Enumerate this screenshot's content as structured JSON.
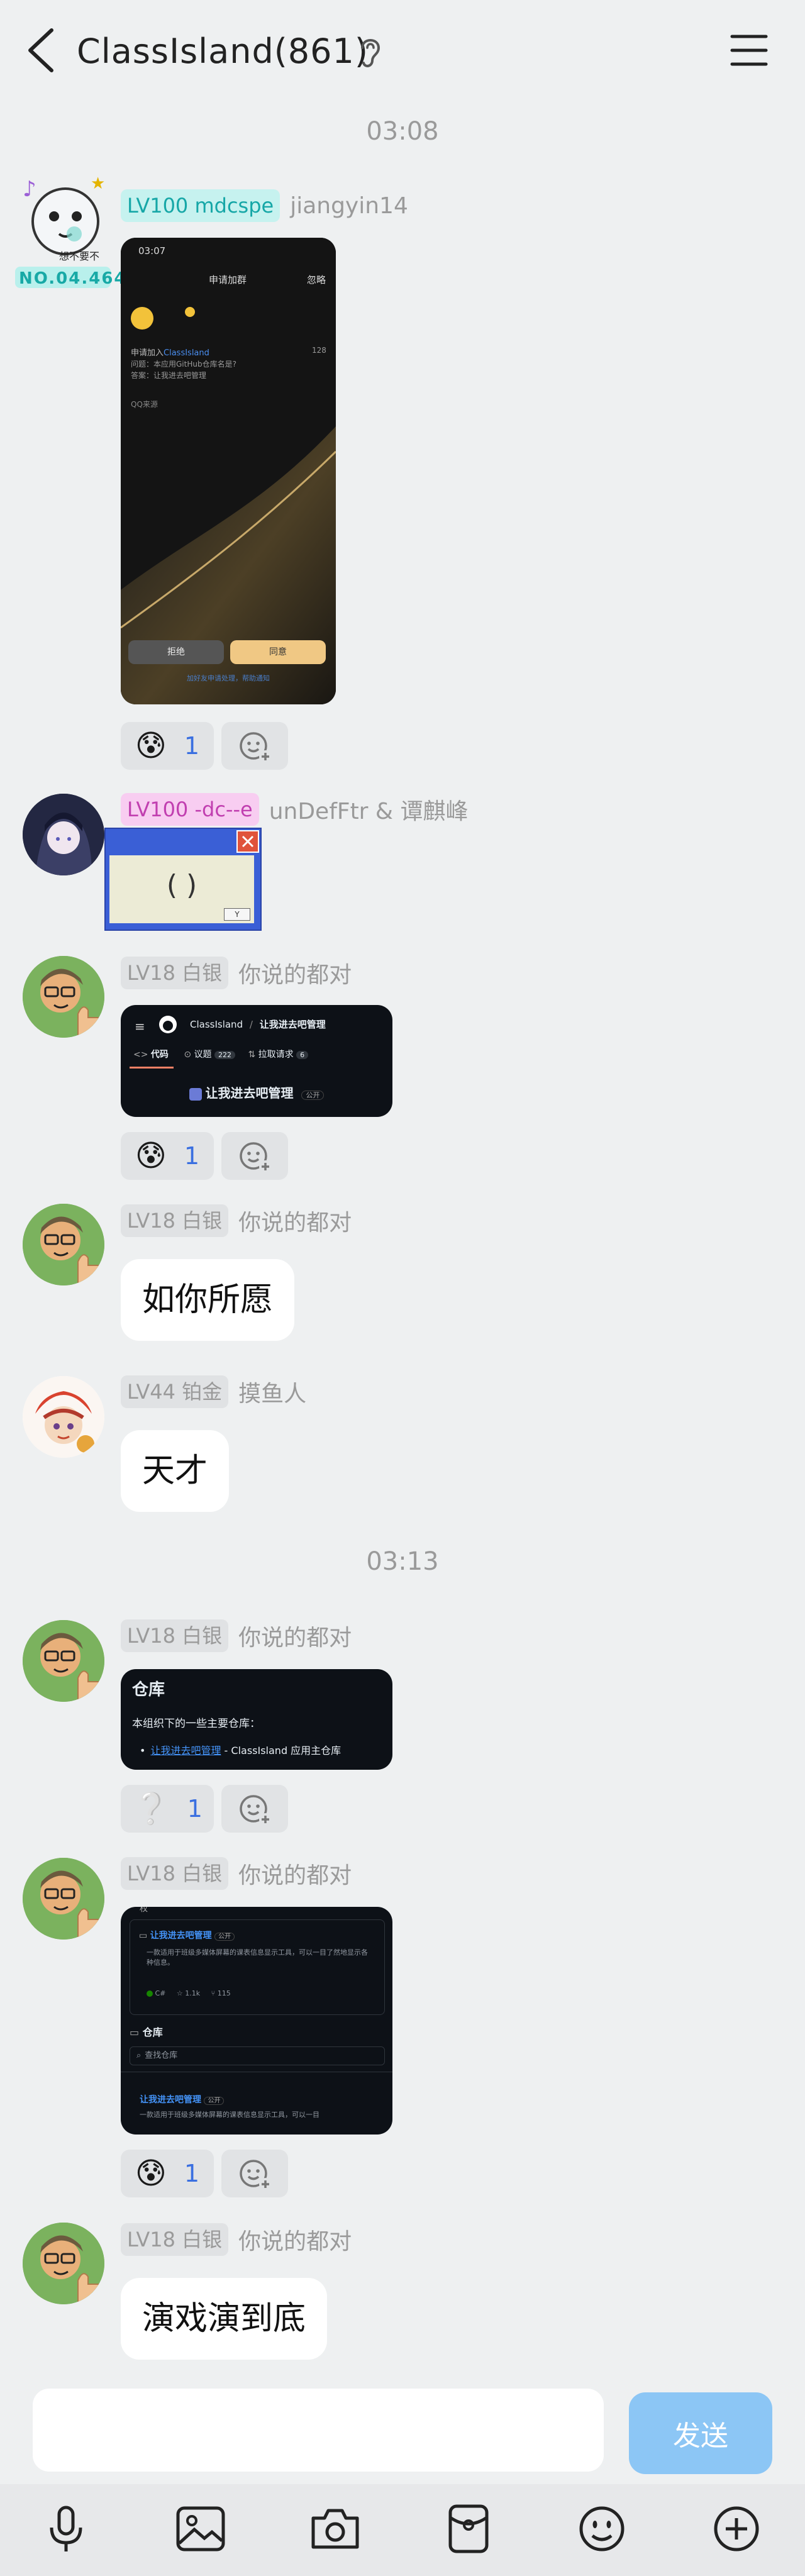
{
  "header": {
    "title": "ClassIsland(861)",
    "back_icon": "back-arrow-icon",
    "ear_icon": "ear-mode-icon",
    "menu_icon": "menu-icon"
  },
  "timestamps": [
    "03:08",
    "03:13"
  ],
  "messages": [
    {
      "badge": "LV100 mdcspe",
      "nickname": "jiangyin14",
      "avatar_caption": "想不要不",
      "avatar_code": "NO.04.464",
      "image_kind": "phone-screenshot",
      "screenshot": {
        "time": "03:07",
        "title": "申请加群",
        "ignore": "忽略",
        "apply_prefix": "申请加入",
        "apply_group": "ClassIsland",
        "count": "128",
        "question": "问题：本应用GitHub仓库名是?",
        "answer": "答案：让我进去吧管理",
        "source": "QQ来源",
        "reject": "拒绝",
        "accept": "同意",
        "footer": "加好友申请处理，帮助通知"
      },
      "reaction": {
        "emoji": "cold-sweat-emoji",
        "count": "1"
      }
    },
    {
      "badge": "LV100 -dc--e",
      "nickname": "unDefFtr & 谭麒峰",
      "sticker_text": "( )",
      "sticker_button": "Y",
      "sticker_icon": "close-icon"
    },
    {
      "badge": "LV18 白银",
      "nickname": "你说的都对",
      "image_kind": "github-header",
      "screenshot": {
        "org": "ClassIsland",
        "slash": "/",
        "repo": "让我进去吧管理",
        "tab_code": "代码",
        "tab_issues": "议题",
        "issues_count": "222",
        "tab_prs": "拉取请求",
        "prs_count": "6",
        "repo_title": "让我进去吧管理",
        "visibility": "公开"
      },
      "reaction": {
        "emoji": "cold-sweat-emoji",
        "count": "1"
      }
    },
    {
      "badge": "LV18 白银",
      "nickname": "你说的都对",
      "text": "如你所愿"
    },
    {
      "badge": "LV44 铂金",
      "nickname": "摸鱼人",
      "text": "天才"
    },
    {
      "badge": "LV18 白银",
      "nickname": "你说的都对",
      "image_kind": "github-repos",
      "screenshot": {
        "heading": "仓库",
        "intro": "本组织下的一些主要仓库：",
        "bullet_link": "让我进去吧管理",
        "bullet_rest": " - ClassIsland 应用主仓库"
      },
      "reaction": {
        "emoji": "question-emoji",
        "count": "1"
      }
    },
    {
      "badge": "LV18 白银",
      "nickname": "你说的都对",
      "image_kind": "github-list",
      "screenshot": {
        "top_cut": "权",
        "repo1": "让我进去吧管理",
        "vis1": "公开",
        "desc1": "一款适用于班级多媒体屏幕的课表信息显示工具，可以一目了然地显示各种信息。",
        "lang": "C#",
        "stars": "1.1k",
        "forks": "115",
        "section": "仓库",
        "search": "查找仓库",
        "repo2": "让我进去吧管理",
        "vis2": "公开",
        "desc2": "一款适用于班级多媒体屏幕的课表信息显示工具，可以一目"
      },
      "reaction": {
        "emoji": "cold-sweat-emoji",
        "count": "1"
      }
    },
    {
      "badge": "LV18 白银",
      "nickname": "你说的都对",
      "text": "演戏演到底"
    }
  ],
  "composer": {
    "placeholder": "",
    "send_label": "发送"
  },
  "toolbar": [
    {
      "icon": "microphone-icon"
    },
    {
      "icon": "image-icon"
    },
    {
      "icon": "camera-icon"
    },
    {
      "icon": "red-packet-icon"
    },
    {
      "icon": "emoji-icon"
    },
    {
      "icon": "plus-icon"
    }
  ],
  "colors": {
    "background": "#eef0f1",
    "send_button": "#8cc6f5",
    "reaction_count": "#3a6fe0",
    "badge_teal": "#16a7a7",
    "badge_pink": "#c13fb0"
  }
}
